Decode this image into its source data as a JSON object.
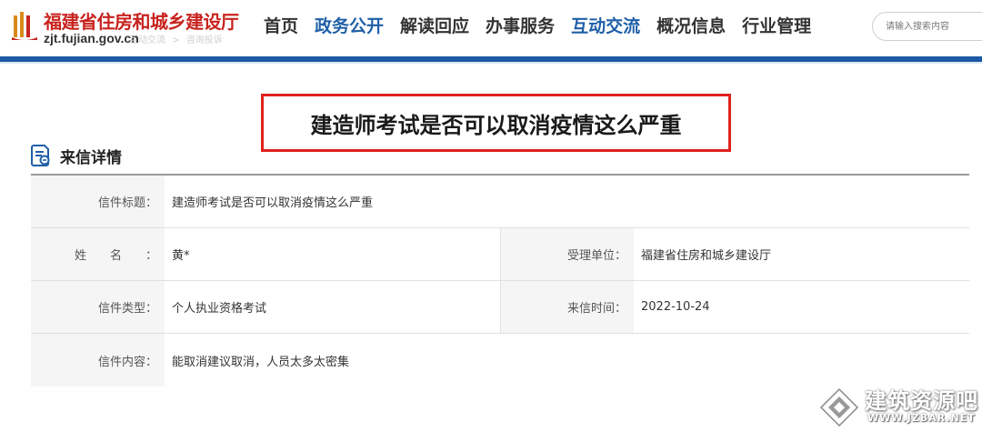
{
  "header": {
    "site_title": "福建省住房和城乡建设厅",
    "site_domain": "zjt.fujian.gov.cn",
    "nav": [
      {
        "label": "首页",
        "active": false
      },
      {
        "label": "政务公开",
        "active": true
      },
      {
        "label": "解读回应",
        "active": false
      },
      {
        "label": "办事服务",
        "active": false
      },
      {
        "label": "互动交流",
        "active": true
      },
      {
        "label": "概况信息",
        "active": false
      },
      {
        "label": "行业管理",
        "active": false
      }
    ],
    "search_placeholder": "请输入搜索内容",
    "breadcrumb": [
      "互动交流",
      ">",
      "咨询投诉"
    ]
  },
  "page": {
    "title": "建造师考试是否可以取消疫情这么严重",
    "section_title": "来信详情"
  },
  "details": {
    "subject_label": "信件标题：",
    "subject_value": "建造师考试是否可以取消疫情这么严重",
    "name_label": "姓名：",
    "name_value": "黄*",
    "dept_label": "受理单位：",
    "dept_value": "福建省住房和城乡建设厅",
    "type_label": "信件类型：",
    "type_value": "个人执业资格考试",
    "time_label": "来信时间：",
    "time_value": "2022-10-24",
    "content_label": "信件内容：",
    "content_value": "能取消建议取消，人员太多太密集"
  },
  "watermark": {
    "name": "建筑资源吧",
    "url": "WWW.JZBAR.NET"
  },
  "colors": {
    "brand_red": "#c8241f",
    "nav_active": "#1f5fa8",
    "header_bar": "#1c5aa6",
    "highlight_border": "#e02020"
  },
  "icons": {
    "logo": "government-emblem-icon",
    "section": "document-list-icon",
    "watermark": "diamond-logo-icon"
  }
}
